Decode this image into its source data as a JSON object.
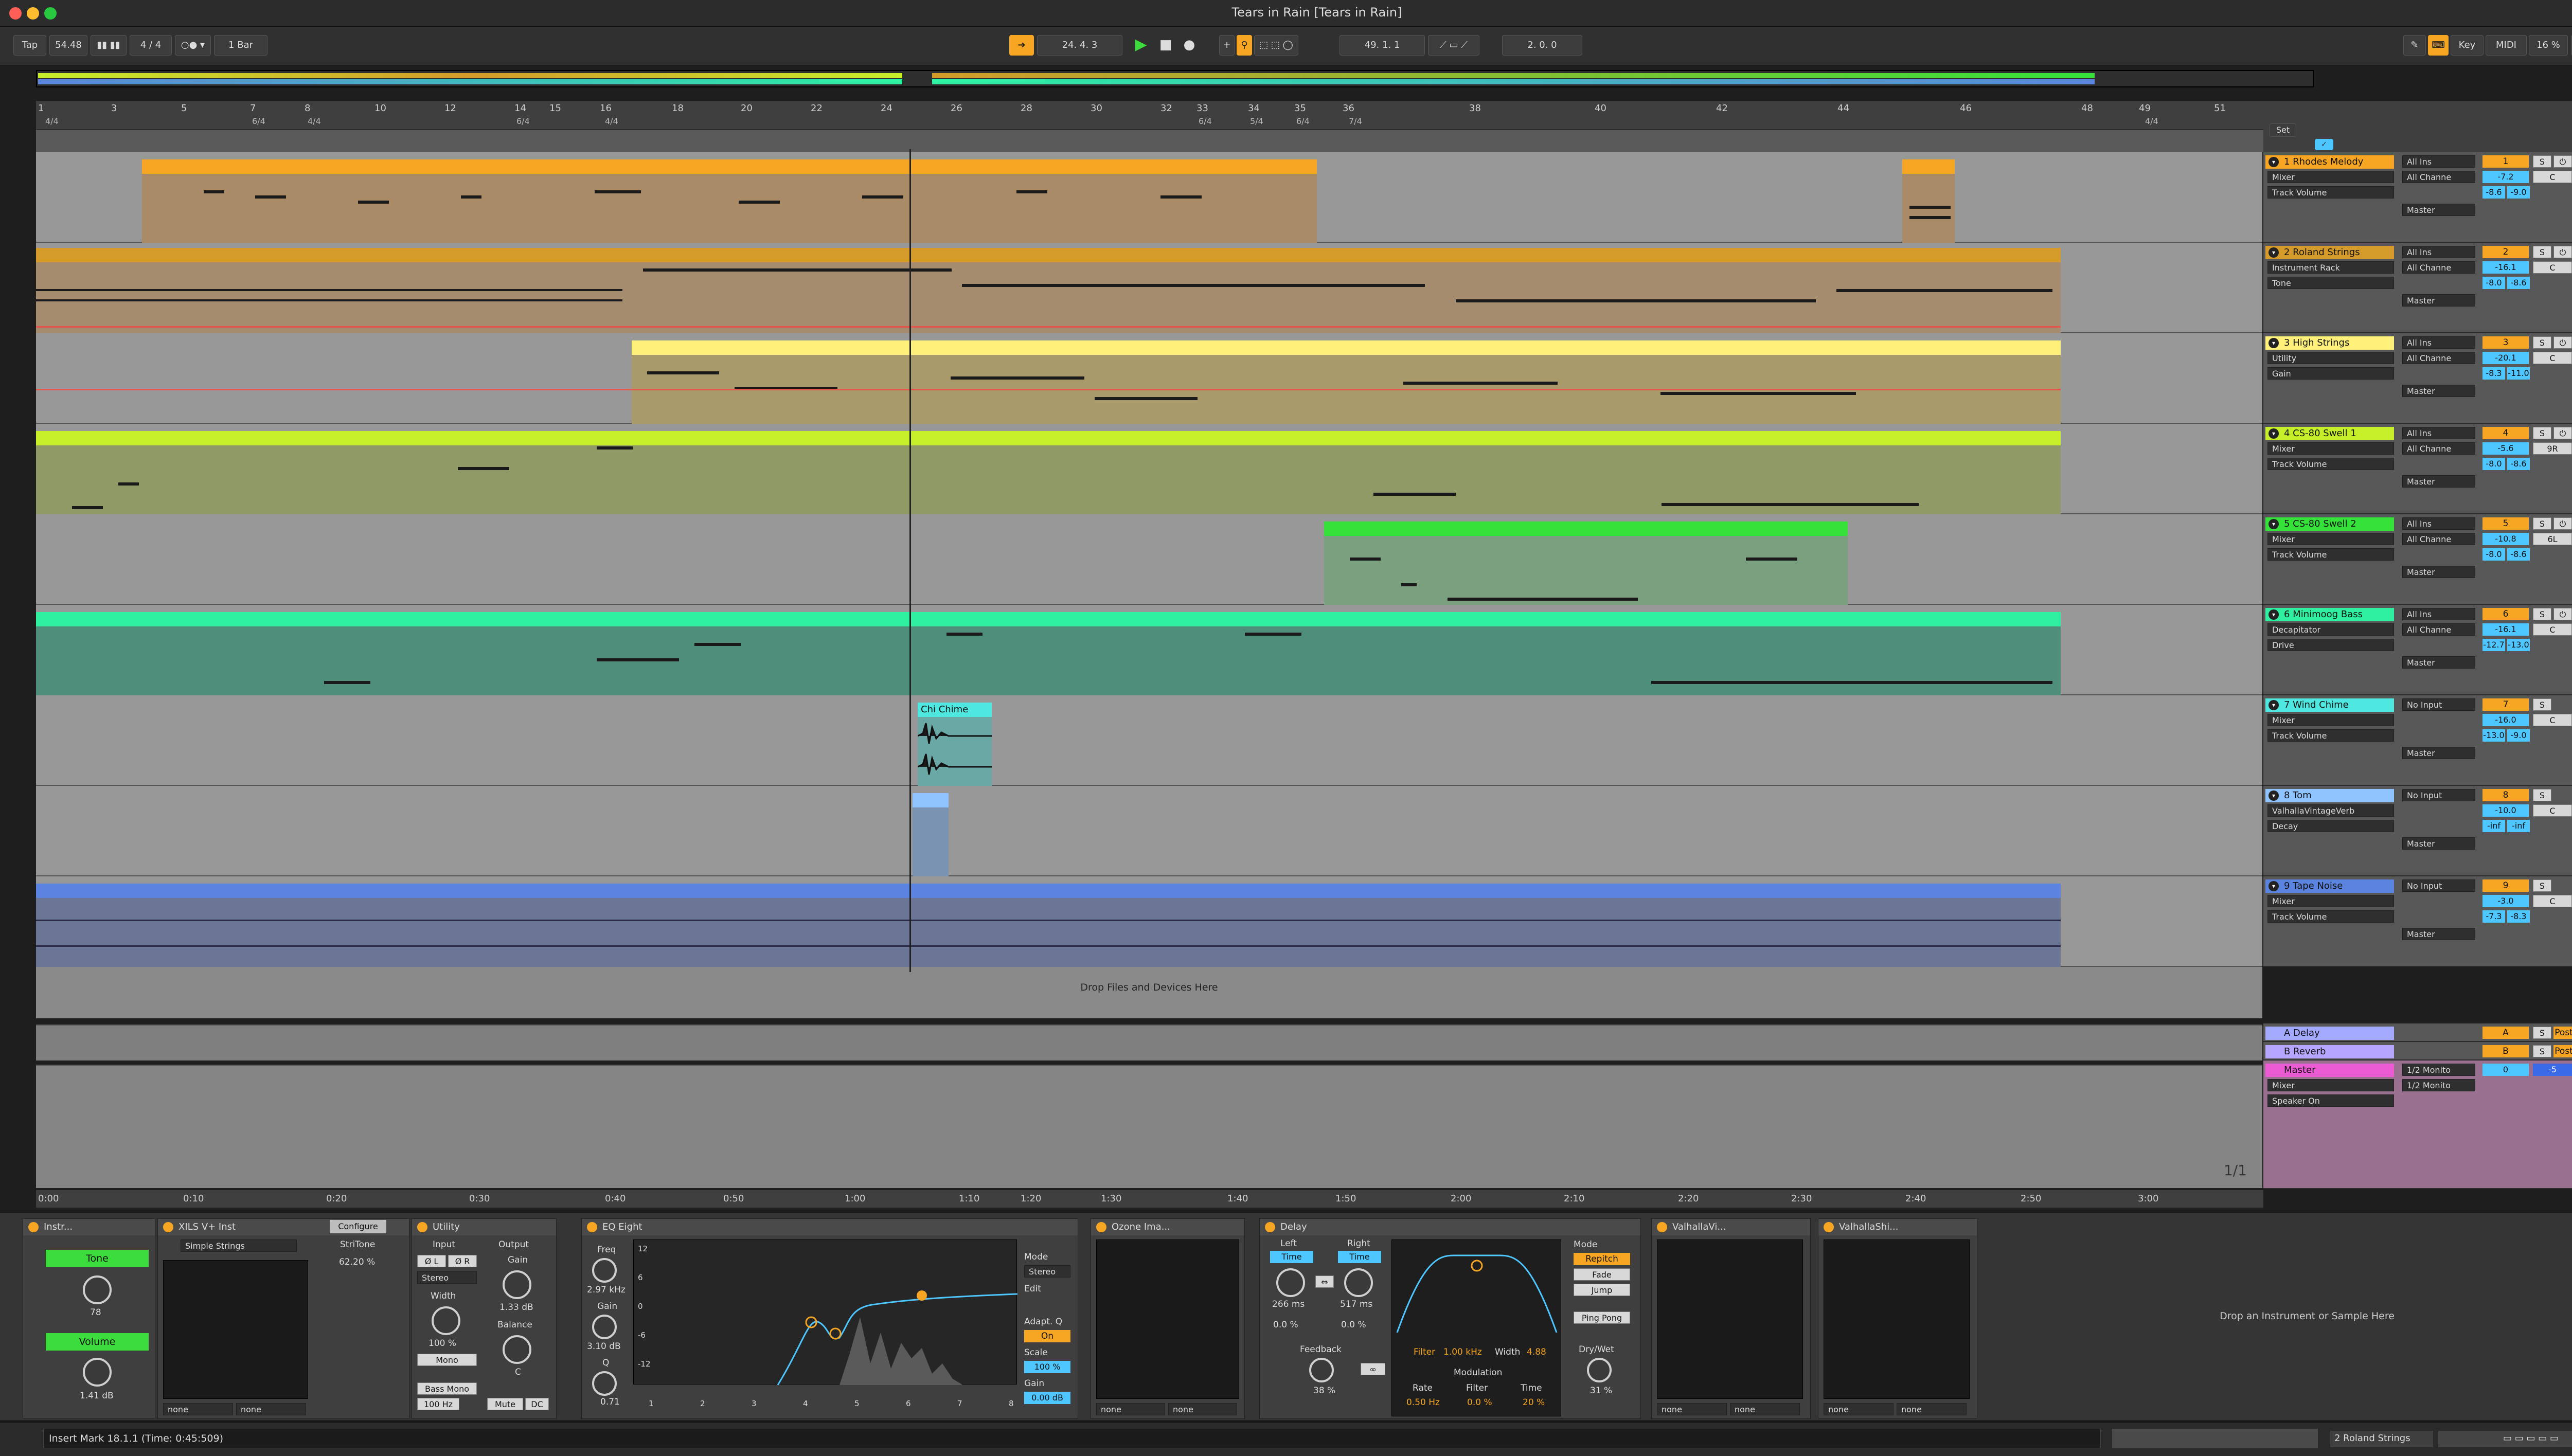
{
  "window": {
    "title": "Tears in Rain  [Tears in Rain]"
  },
  "control_bar": {
    "tap_label": "Tap",
    "tempo": "54.48",
    "signature": "4 / 4",
    "quantize": "1 Bar",
    "arrangement_position": "24.  4.  3",
    "loop_start": "49.  1.  1",
    "loop_length": "2.  0.  0",
    "key_label": "Key",
    "midi_label": "MIDI",
    "cpu": "16 %"
  },
  "ruler": {
    "bars": [
      "1",
      "3",
      "5",
      "7",
      "8",
      "10",
      "12",
      "14",
      "15",
      "16",
      "18",
      "20",
      "22",
      "24",
      "26",
      "28",
      "30",
      "32",
      "33",
      "34",
      "35",
      "36",
      "38",
      "40",
      "42",
      "44",
      "46",
      "48",
      "49",
      "51"
    ],
    "signatures": [
      "4/4",
      "6/4",
      "4/4",
      "6/4",
      "4/4",
      "6/4",
      "5/4",
      "6/4",
      "7/4",
      "4/4"
    ],
    "set_label": "Set"
  },
  "time_ruler": {
    "marks": [
      "0:00",
      "0:10",
      "0:20",
      "0:30",
      "0:40",
      "0:50",
      "1:00",
      "1:10",
      "1:20",
      "1:30",
      "1:40",
      "1:50",
      "2:00",
      "2:10",
      "2:20",
      "2:30",
      "2:40",
      "2:50",
      "3:00"
    ],
    "zoom_label": "1/1"
  },
  "arrangement": {
    "drop_hint": "Drop Files and Devices Here",
    "clip_names": {
      "chime": "Chi Chime"
    }
  },
  "tracks": [
    {
      "name": "1 Rhodes Melody",
      "color": "#f6a623",
      "input": "All Ins",
      "channel": "All Channe",
      "device": "Mixer",
      "param": "Track Volume",
      "out": "Master",
      "num": "1",
      "vol": "-7.2",
      "pan": "C",
      "a": "-8.6",
      "b": "-9.0"
    },
    {
      "name": "2 Roland Strings",
      "color": "#d49a2a",
      "input": "All Ins",
      "channel": "All Channe",
      "device": "Instrument Rack",
      "param": "Tone",
      "out": "Master",
      "num": "2",
      "vol": "-16.1",
      "pan": "C",
      "a": "-8.0",
      "b": "-8.6"
    },
    {
      "name": "3 High Strings",
      "color": "#fff07a",
      "input": "All Ins",
      "channel": "All Channe",
      "device": "Utility",
      "param": "Gain",
      "out": "Master",
      "num": "3",
      "vol": "-20.1",
      "pan": "C",
      "a": "-8.3",
      "b": "-11.0"
    },
    {
      "name": "4 CS-80 Swell 1",
      "color": "#c6ef2a",
      "input": "All Ins",
      "channel": "All Channe",
      "device": "Mixer",
      "param": "Track Volume",
      "out": "Master",
      "num": "4",
      "vol": "-5.6",
      "pan": "9R",
      "a": "-8.0",
      "b": "-8.6"
    },
    {
      "name": "5 CS-80 Swell 2",
      "color": "#35e23a",
      "input": "All Ins",
      "channel": "All Channe",
      "device": "Mixer",
      "param": "Track Volume",
      "out": "Master",
      "num": "5",
      "vol": "-10.8",
      "pan": "6L",
      "a": "-8.0",
      "b": "-8.6"
    },
    {
      "name": "6 Minimoog Bass",
      "color": "#2ef0a0",
      "input": "All Ins",
      "channel": "All Channe",
      "device": "Decapitator",
      "param": "Drive",
      "out": "Master",
      "num": "6",
      "vol": "-16.1",
      "pan": "C",
      "a": "-12.7",
      "b": "-13.0"
    },
    {
      "name": "7 Wind Chime",
      "color": "#4fe8e0",
      "input": "No Input",
      "channel": "",
      "device": "Mixer",
      "param": "Track Volume",
      "out": "Master",
      "num": "7",
      "vol": "-16.0",
      "pan": "C",
      "a": "-13.0",
      "b": "-9.0"
    },
    {
      "name": "8 Tom",
      "color": "#8fc4ff",
      "input": "No Input",
      "channel": "",
      "device": "ValhallaVintageVerb",
      "param": "Decay",
      "out": "Master",
      "num": "8",
      "vol": "-10.0",
      "pan": "C",
      "a": "-inf",
      "b": "-inf"
    },
    {
      "name": "9 Tape Noise",
      "color": "#5a84e0",
      "input": "No Input",
      "channel": "",
      "device": "Mixer",
      "param": "Track Volume",
      "out": "Master",
      "num": "9",
      "vol": "-3.0",
      "pan": "C",
      "a": "-7.3",
      "b": "-8.3"
    }
  ],
  "returns": [
    {
      "name": "A Delay",
      "color": "#a3a9ff",
      "letter": "A",
      "post": "Post"
    },
    {
      "name": "B Reverb",
      "color": "#b6a6ff",
      "letter": "B",
      "post": "Post"
    }
  ],
  "master": {
    "name": "Master",
    "color": "#ec5ad4",
    "device": "Mixer",
    "param": "Speaker On",
    "in1": "1/2 Monito",
    "in2": "1/2 Monito",
    "num": "0",
    "vol": "-5"
  },
  "devices": {
    "rack": {
      "title": "Instr...",
      "macro1": "Tone",
      "macro1_val": "78",
      "macro2": "Volume",
      "macro2_val": "1.41 dB"
    },
    "xils": {
      "title": "XILS V+ Inst",
      "configure": "Configure",
      "preset": "Simple Strings",
      "param": "StriTone",
      "param_val": "62.20 %",
      "out1": "none",
      "out2": "none"
    },
    "utility": {
      "title": "Utility",
      "input_label": "Input",
      "output_label": "Output",
      "phase_l": "Ø L",
      "phase_r": "Ø R",
      "channel_mode": "Stereo",
      "gain_label": "Gain",
      "gain_val": "1.33 dB",
      "width_label": "Width",
      "width_val": "100 %",
      "mono": "Mono",
      "balance_label": "Balance",
      "balance_val": "C",
      "bass_mono": "Bass Mono",
      "bass_freq": "100 Hz",
      "mute": "Mute",
      "dc": "DC"
    },
    "eq": {
      "title": "EQ Eight",
      "freq_label": "Freq",
      "freq_val": "2.97 kHz",
      "gain_label": "Gain",
      "gain_val": "3.10 dB",
      "q_label": "Q",
      "q_val": "0.71",
      "mode_label": "Mode",
      "mode_val": "Stereo",
      "edit_label": "Edit",
      "adapt_label": "Adapt. Q",
      "adapt_val": "On",
      "scale_label": "Scale",
      "scale_val": "100 %",
      "gain2_label": "Gain",
      "gain2_val": "0.00 dB",
      "y_ticks": [
        "12",
        "6",
        "0",
        "-6",
        "-12"
      ],
      "bands": [
        "1",
        "2",
        "3",
        "4",
        "5",
        "6",
        "7",
        "8"
      ]
    },
    "ozone": {
      "title": "Ozone Ima...",
      "out1": "none",
      "out2": "none"
    },
    "delay": {
      "title": "Delay",
      "left": "Left",
      "right": "Right",
      "time": "Time",
      "left_ms": "266 ms",
      "right_ms": "517 ms",
      "left_pct": "0.0 %",
      "right_pct": "0.0 %",
      "feedback_label": "Feedback",
      "feedback_val": "38 %",
      "filter_label": "Filter",
      "filter_freq": "1.00 kHz",
      "width_label": "Width",
      "width_val": "4.88",
      "modulation": "Modulation",
      "rate_label": "Rate",
      "rate_val": "0.50 Hz",
      "filter2_label": "Filter",
      "filter2_val": "0.0 %",
      "time_label": "Time",
      "time_val": "20 %",
      "mode_label": "Mode",
      "modes": [
        "Repitch",
        "Fade",
        "Jump"
      ],
      "ping_pong": "Ping Pong",
      "drywet_label": "Dry/Wet",
      "drywet_val": "31 %"
    },
    "valhalla1": {
      "title": "ValhallaVi...",
      "out1": "none",
      "out2": "none"
    },
    "valhalla2": {
      "title": "ValhallaShi...",
      "out1": "none",
      "out2": "none"
    },
    "drop_hint": "Drop an Instrument or Sample Here"
  },
  "status_bar": {
    "text": "Insert Mark 18.1.1 (Time: 0:45:509)",
    "track": "2 Roland Strings"
  }
}
